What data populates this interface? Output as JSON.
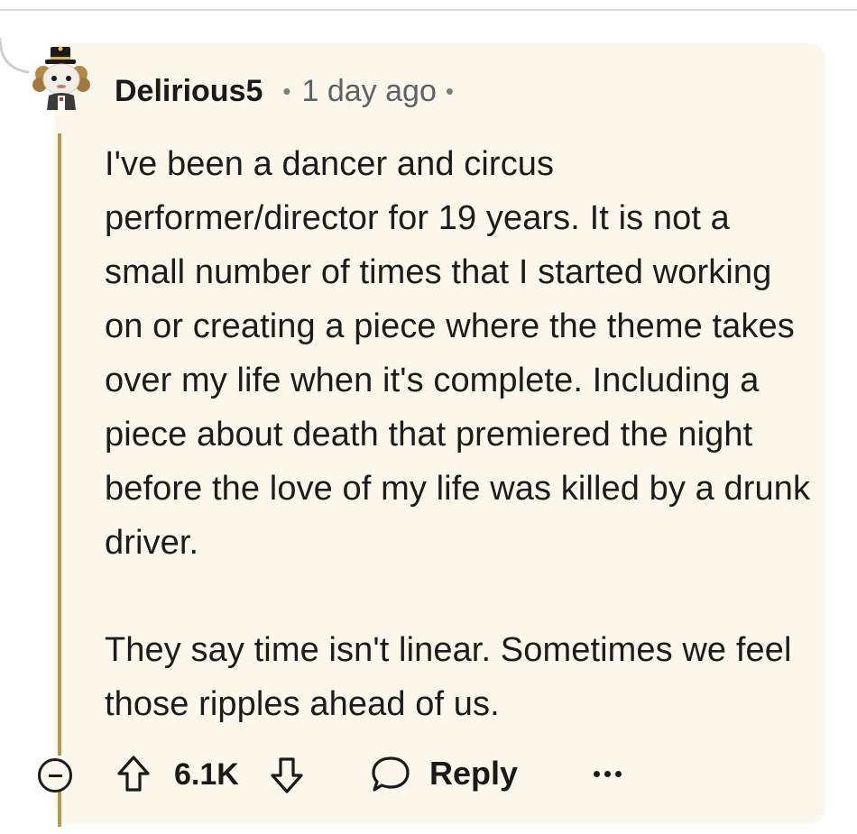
{
  "comment": {
    "username": "Delirious5",
    "separator": "•",
    "timestamp": "1 day ago",
    "trailing_separator": "•",
    "body": [
      "I've been a dancer and circus performer/director for 19 years. It is not a small number of times that I started working on or creating a piece where the theme takes over my life when it's complete. Including a piece about death that premiered the night before the love of my life was killed by a drunk driver.",
      "They say time isn't linear. Sometimes we feel those ripples ahead of us."
    ],
    "avatar_icon": "snoo-avatar-top-hat-icon"
  },
  "actions": {
    "collapse_icon": "minus-circle-icon",
    "upvote_icon": "upvote-arrow-icon",
    "score": "6.1K",
    "downvote_icon": "downvote-arrow-icon",
    "reply_icon": "speech-bubble-icon",
    "reply_label": "Reply",
    "more_icon": "more-dots-icon"
  },
  "colors": {
    "card_background": "#fbf7ea",
    "thread_line": "#b39a4a",
    "text": "#1a1a1b",
    "muted": "#5e6266"
  }
}
